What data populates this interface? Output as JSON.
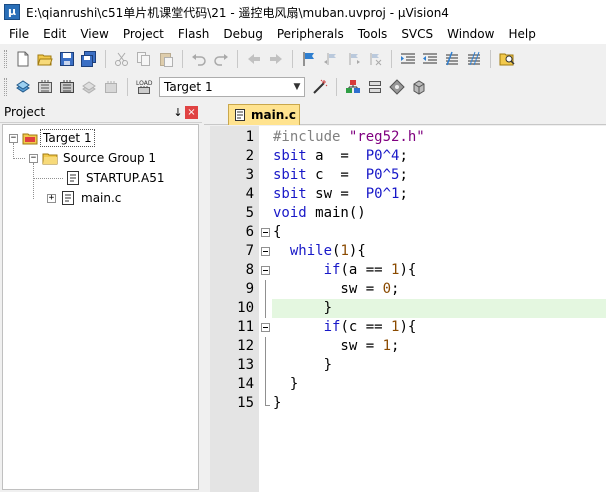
{
  "window": {
    "title": "E:\\qianrushi\\c51单片机课堂代码\\21 - 遥控电风扇\\muban.uvproj - µVision4"
  },
  "menu": [
    "File",
    "Edit",
    "View",
    "Project",
    "Flash",
    "Debug",
    "Peripherals",
    "Tools",
    "SVCS",
    "Window",
    "Help"
  ],
  "toolbar2": {
    "target": "Target 1"
  },
  "project_panel": {
    "title": "Project",
    "pin": "↓",
    "close": "×",
    "tree": [
      {
        "label": "Target 1",
        "expander": "−"
      },
      {
        "label": "Source Group 1",
        "expander": "−"
      },
      {
        "label": "STARTUP.A51"
      },
      {
        "label": "main.c",
        "expander": "+"
      }
    ]
  },
  "editor": {
    "tab": "main.c",
    "highlighted_line": 10,
    "lines": [
      {
        "n": "1",
        "segs": [
          [
            "pp",
            "#include "
          ],
          [
            "str",
            "\"reg52.h\""
          ]
        ]
      },
      {
        "n": "2",
        "segs": [
          [
            "kw",
            "sbit"
          ],
          [
            "",
            " a  =  "
          ],
          [
            "kw",
            "P0^4"
          ],
          [
            "",
            ";"
          ]
        ]
      },
      {
        "n": "3",
        "segs": [
          [
            "kw",
            "sbit"
          ],
          [
            "",
            " c  =  "
          ],
          [
            "kw",
            "P0^5"
          ],
          [
            "",
            ";"
          ]
        ]
      },
      {
        "n": "4",
        "segs": [
          [
            "kw",
            "sbit"
          ],
          [
            "",
            " sw =  "
          ],
          [
            "kw",
            "P0^1"
          ],
          [
            "",
            ";"
          ]
        ]
      },
      {
        "n": "5",
        "segs": [
          [
            "kw",
            "void"
          ],
          [
            "",
            " main()"
          ]
        ]
      },
      {
        "n": "6",
        "segs": [
          [
            "",
            "{"
          ]
        ]
      },
      {
        "n": "7",
        "segs": [
          [
            "",
            "  "
          ],
          [
            "kw",
            "while"
          ],
          [
            "",
            "("
          ],
          [
            "num",
            "1"
          ],
          [
            "",
            "){"
          ]
        ]
      },
      {
        "n": "8",
        "segs": [
          [
            "",
            "      "
          ],
          [
            "kw",
            "if"
          ],
          [
            "",
            "(a == "
          ],
          [
            "num",
            "1"
          ],
          [
            "",
            "){"
          ]
        ]
      },
      {
        "n": "9",
        "segs": [
          [
            "",
            "        sw = "
          ],
          [
            "num",
            "0"
          ],
          [
            "",
            ";"
          ]
        ]
      },
      {
        "n": "10",
        "segs": [
          [
            "",
            "      }"
          ]
        ]
      },
      {
        "n": "11",
        "segs": [
          [
            "",
            "      "
          ],
          [
            "kw",
            "if"
          ],
          [
            "",
            "(c == "
          ],
          [
            "num",
            "1"
          ],
          [
            "",
            "){"
          ]
        ]
      },
      {
        "n": "12",
        "segs": [
          [
            "",
            "        sw = "
          ],
          [
            "num",
            "1"
          ],
          [
            "",
            ";"
          ]
        ]
      },
      {
        "n": "13",
        "segs": [
          [
            "",
            "      }"
          ]
        ]
      },
      {
        "n": "14",
        "segs": [
          [
            "",
            "  }"
          ]
        ]
      },
      {
        "n": "15",
        "segs": [
          [
            "",
            "}"
          ]
        ]
      }
    ]
  }
}
